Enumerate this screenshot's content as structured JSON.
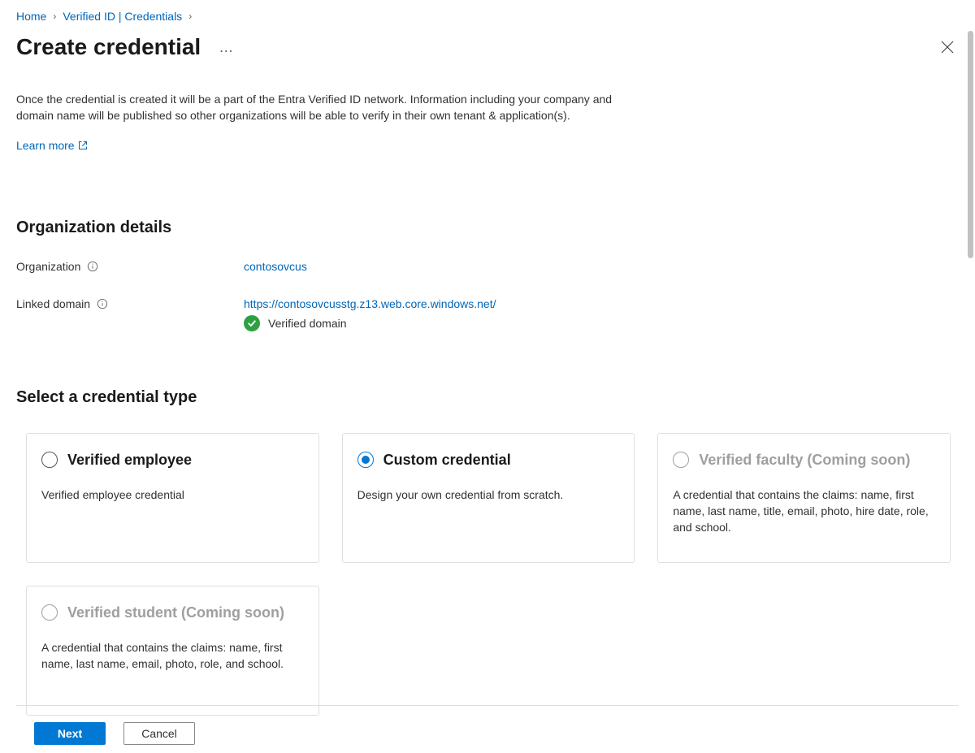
{
  "breadcrumb": {
    "home": "Home",
    "verified_id": "Verified ID | Credentials"
  },
  "header": {
    "title": "Create credential"
  },
  "intro": {
    "text": "Once the credential is created it will be a part of the Entra Verified ID network. Information including your company and domain name will be published so other organizations will be able to verify in their own tenant & application(s).",
    "learn_more": "Learn more"
  },
  "org": {
    "heading": "Organization details",
    "org_label": "Organization",
    "org_value": "contosovcus",
    "domain_label": "Linked domain",
    "domain_value": "https://contosovcusstg.z13.web.core.windows.net/",
    "verified_text": "Verified domain"
  },
  "select": {
    "heading": "Select a credential type",
    "cards": [
      {
        "id": "verified-employee",
        "title": "Verified employee",
        "desc": "Verified employee credential",
        "selected": false,
        "disabled": false
      },
      {
        "id": "custom-credential",
        "title": "Custom credential",
        "desc": "Design your own credential from scratch.",
        "selected": true,
        "disabled": false
      },
      {
        "id": "verified-faculty",
        "title": "Verified faculty (Coming soon)",
        "desc": "A credential that contains the claims: name, first name, last name, title, email, photo, hire date, role, and school.",
        "selected": false,
        "disabled": true
      },
      {
        "id": "verified-student",
        "title": "Verified student (Coming soon)",
        "desc": "A credential that contains the claims: name, first name, last name, email, photo, role, and school.",
        "selected": false,
        "disabled": true
      }
    ]
  },
  "footer": {
    "next": "Next",
    "cancel": "Cancel"
  }
}
